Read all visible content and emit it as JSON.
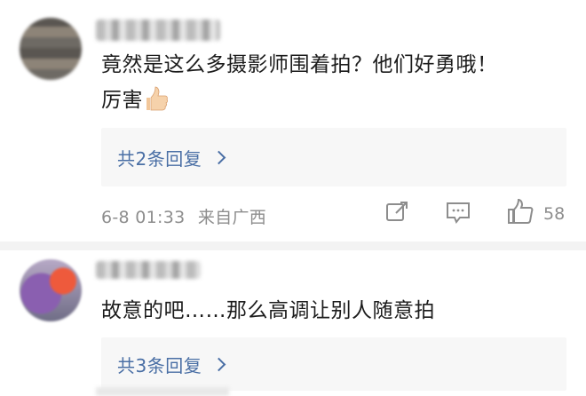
{
  "comments": [
    {
      "text": "竟然是这么多摄影师围着拍？他们好勇哦！",
      "text_line2": "厉害",
      "replies_label": "共2条回复",
      "time": "6-8 01:33",
      "location": "来自广西",
      "likes": "58",
      "emoji": "thumbs-up-emoji"
    },
    {
      "text": "故意的吧……那么高调让别人随意拍",
      "replies_label": "共3条回复"
    }
  ],
  "icons": [
    "share-icon",
    "comment-icon",
    "like-icon",
    "chevron-right-icon"
  ],
  "colors": {
    "link": "#4a6fa5",
    "meta": "#8d8d8d",
    "reply_bg": "#f7f7f7",
    "divider": "#f3f3f3"
  }
}
